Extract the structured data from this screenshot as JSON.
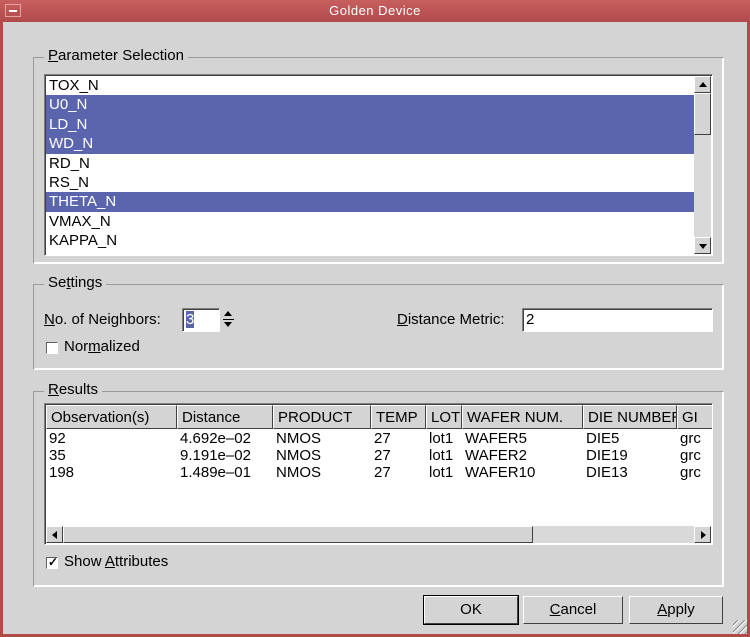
{
  "window": {
    "title": "Golden Device"
  },
  "parameter_selection": {
    "group_label_key": "P",
    "group_label_rest": "arameter Selection",
    "items": [
      {
        "label": "TOX_N",
        "selected": false
      },
      {
        "label": "U0_N",
        "selected": true
      },
      {
        "label": "LD_N",
        "selected": true
      },
      {
        "label": "WD_N",
        "selected": true
      },
      {
        "label": "RD_N",
        "selected": false
      },
      {
        "label": "RS_N",
        "selected": false
      },
      {
        "label": "THETA_N",
        "selected": true
      },
      {
        "label": "VMAX_N",
        "selected": false
      },
      {
        "label": "KAPPA_N",
        "selected": false
      }
    ]
  },
  "settings": {
    "group_label_pre": "Se",
    "group_label_key": "t",
    "group_label_rest": "tings",
    "neighbors_label_key": "N",
    "neighbors_label_rest": "o. of Neighbors:",
    "neighbors_value": "3",
    "distance_label_key": "D",
    "distance_label_rest": "istance Metric:",
    "distance_value": "2",
    "normalized_pre": "Nor",
    "normalized_key": "m",
    "normalized_rest": "alized",
    "normalized_checked": false
  },
  "results": {
    "group_label_key": "R",
    "group_label_rest": "esults",
    "columns": [
      "Observation(s)",
      "Distance",
      "PRODUCT",
      "TEMP",
      "LOT",
      "WAFER NUM.",
      "DIE NUMBER",
      "GI"
    ],
    "rows": [
      [
        "92",
        "4.692e–02",
        "NMOS",
        "27",
        "lot1",
        "WAFER5",
        "DIE5",
        "grc"
      ],
      [
        "35",
        "9.191e–02",
        "NMOS",
        "27",
        "lot1",
        "WAFER2",
        "DIE19",
        "grc"
      ],
      [
        "198",
        "1.489e–01",
        "NMOS",
        "27",
        "lot1",
        "WAFER10",
        "DIE13",
        "grc"
      ]
    ],
    "show_attributes_pre": "Show ",
    "show_attributes_key": "A",
    "show_attributes_rest": "ttributes",
    "show_attributes_checked": true
  },
  "buttons": {
    "ok": "OK",
    "cancel_key": "C",
    "cancel_rest": "ancel",
    "apply_key": "A",
    "apply_rest": "pply"
  },
  "colors": {
    "titlebar": "#b04a4a",
    "selection": "#5a65ad",
    "face": "#d4d4d4"
  }
}
